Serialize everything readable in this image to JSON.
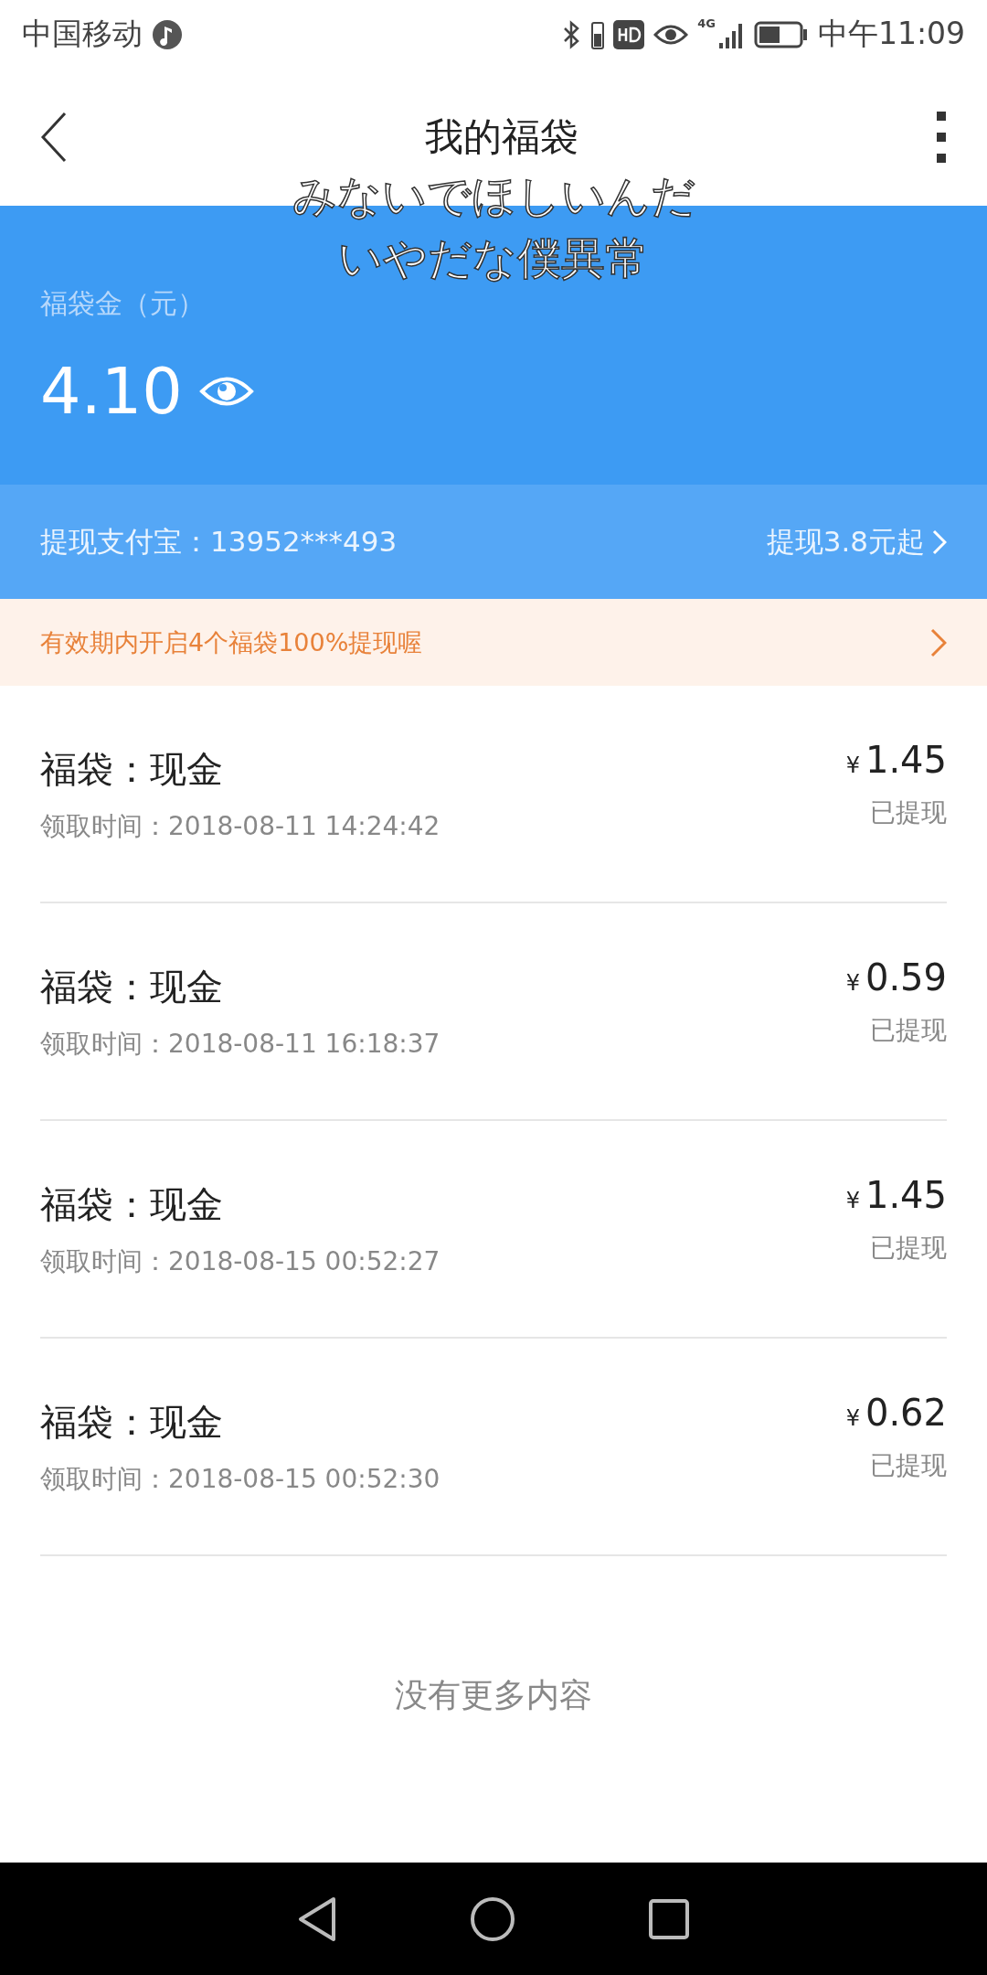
{
  "status_bar": {
    "carrier": "中国移动",
    "time": "中午11:09",
    "network": "4G"
  },
  "header": {
    "title": "我的福袋"
  },
  "caption": [
    "みないでほしいんだ",
    "いやだな僕異常"
  ],
  "balance": {
    "label": "福袋金（元）",
    "amount": "4.10",
    "withdraw_account": "提现支付宝：13952***493",
    "withdraw_link": "提现3.8元起"
  },
  "notice": {
    "text": "有效期内开启4个福袋100%提现喔"
  },
  "records": [
    {
      "title": "福袋：现金",
      "time": "领取时间：2018-08-11 14:24:42",
      "currency": "¥",
      "amount": "1.45",
      "status": "已提现"
    },
    {
      "title": "福袋：现金",
      "time": "领取时间：2018-08-11 16:18:37",
      "currency": "¥",
      "amount": "0.59",
      "status": "已提现"
    },
    {
      "title": "福袋：现金",
      "time": "领取时间：2018-08-15 00:52:27",
      "currency": "¥",
      "amount": "1.45",
      "status": "已提现"
    },
    {
      "title": "福袋：现金",
      "time": "领取时间：2018-08-15 00:52:30",
      "currency": "¥",
      "amount": "0.62",
      "status": "已提现"
    }
  ],
  "footer": {
    "text": "没有更多内容"
  }
}
